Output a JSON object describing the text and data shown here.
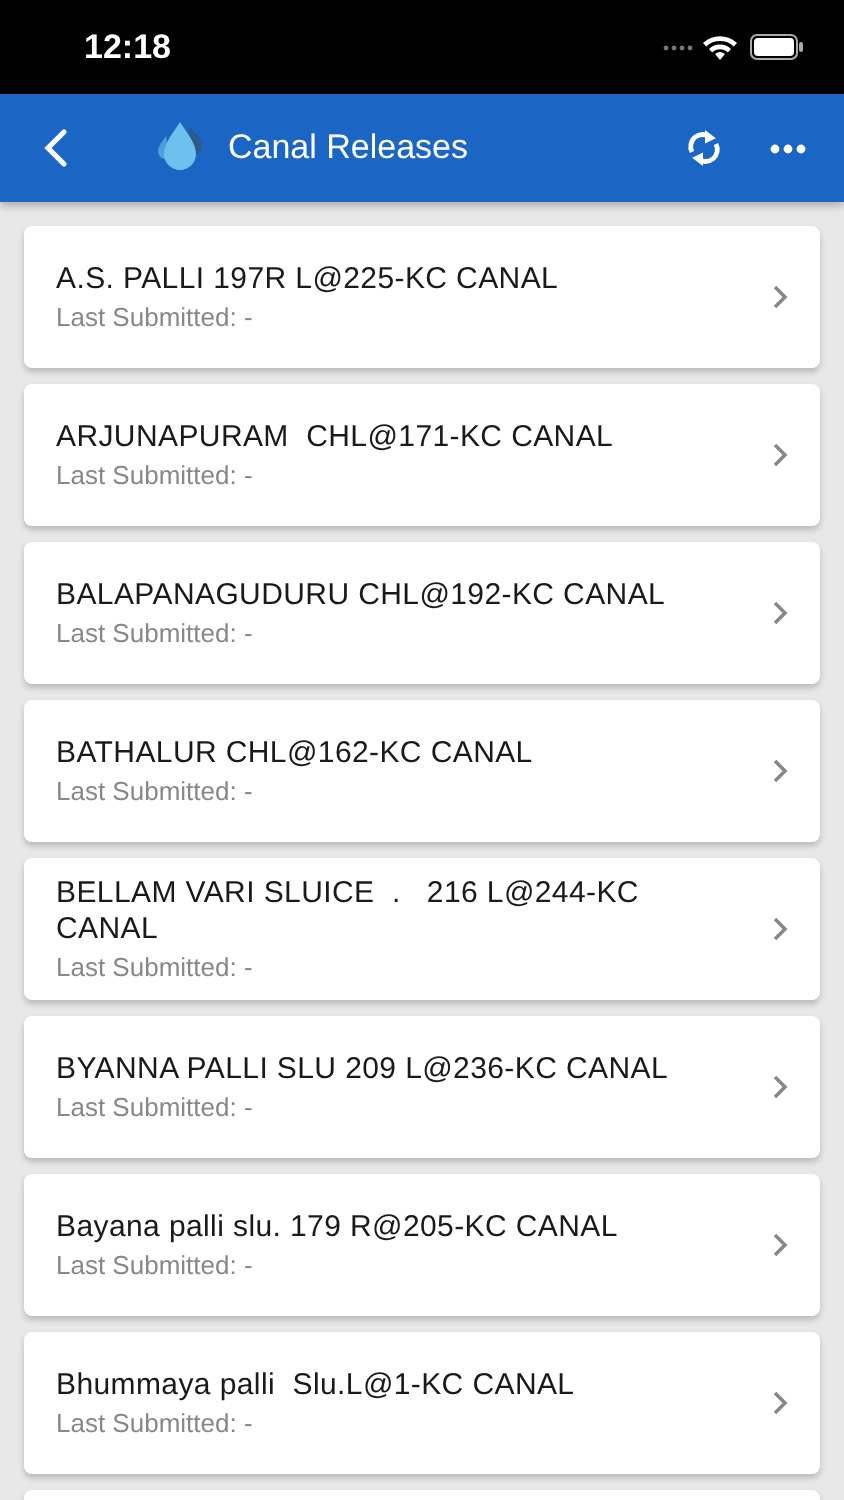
{
  "status_bar": {
    "time": "12:18"
  },
  "header": {
    "title": "Canal Releases"
  },
  "releases": [
    {
      "name": "A.S. PALLI 197R L@225-KC CANAL",
      "subtitle": "Last Submitted: -"
    },
    {
      "name": "ARJUNAPURAM  CHL@171-KC CANAL",
      "subtitle": "Last Submitted: -"
    },
    {
      "name": "BALAPANAGUDURU CHL@192-KC CANAL",
      "subtitle": "Last Submitted: -"
    },
    {
      "name": "BATHALUR CHL@162-KC CANAL",
      "subtitle": "Last Submitted: -"
    },
    {
      "name": "BELLAM VARI SLUICE  .   216 L@244-KC CANAL",
      "subtitle": "Last Submitted: -"
    },
    {
      "name": "BYANNA PALLI SLU 209 L@236-KC CANAL",
      "subtitle": "Last Submitted: -"
    },
    {
      "name": "Bayana palli slu. 179 R@205-KC CANAL",
      "subtitle": "Last Submitted: -"
    },
    {
      "name": "Bhummaya palli  Slu.L@1-KC CANAL",
      "subtitle": "Last Submitted: -"
    }
  ]
}
